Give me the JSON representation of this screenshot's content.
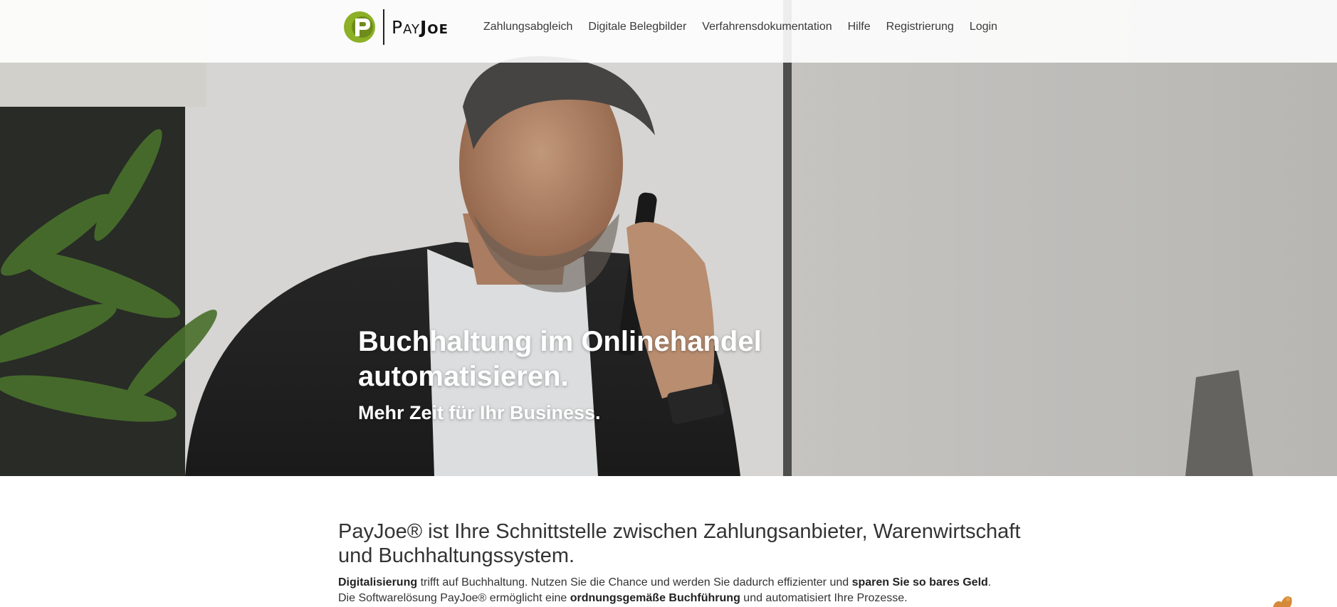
{
  "brand": {
    "name_part1": "Pay",
    "name_part2": "Joe",
    "logo_letter": "P"
  },
  "nav": {
    "items": [
      {
        "label": "Zahlungsabgleich"
      },
      {
        "label": "Digitale Belegbilder"
      },
      {
        "label": "Verfahrensdokumentation"
      },
      {
        "label": "Hilfe"
      },
      {
        "label": "Registrierung"
      },
      {
        "label": "Login"
      }
    ]
  },
  "hero": {
    "title": "Buchhaltung im Onlinehandel automatisieren.",
    "subtitle": "Mehr Zeit für Ihr Business."
  },
  "intro": {
    "heading": "PayJoe® ist Ihre Schnittstelle zwischen Zahlungsanbieter, Warenwirtschaft und Buchhaltungssystem.",
    "line1": {
      "bold_start": "Digitalisierung",
      "text_mid": " trifft auf Buchhaltung. Nutzen Sie die Chance und werden Sie dadurch effizienter und ",
      "bold_end": "sparen Sie so bares Geld",
      "text_end": "."
    },
    "line2": {
      "text_start": "Die Softwarelösung PayJoe® ermöglicht eine ",
      "bold_mid": "ordnungsgemäße Buchführung",
      "text_end": " und automatisiert Ihre Prozesse."
    }
  },
  "colors": {
    "logo_green": "#8cb026",
    "nav_bg": "#ffffff",
    "text": "#333333",
    "hero_text": "#ffffff"
  },
  "icons": {
    "logo": "payjoe-p-logo-icon",
    "corner": "feedback-widget-icon"
  }
}
